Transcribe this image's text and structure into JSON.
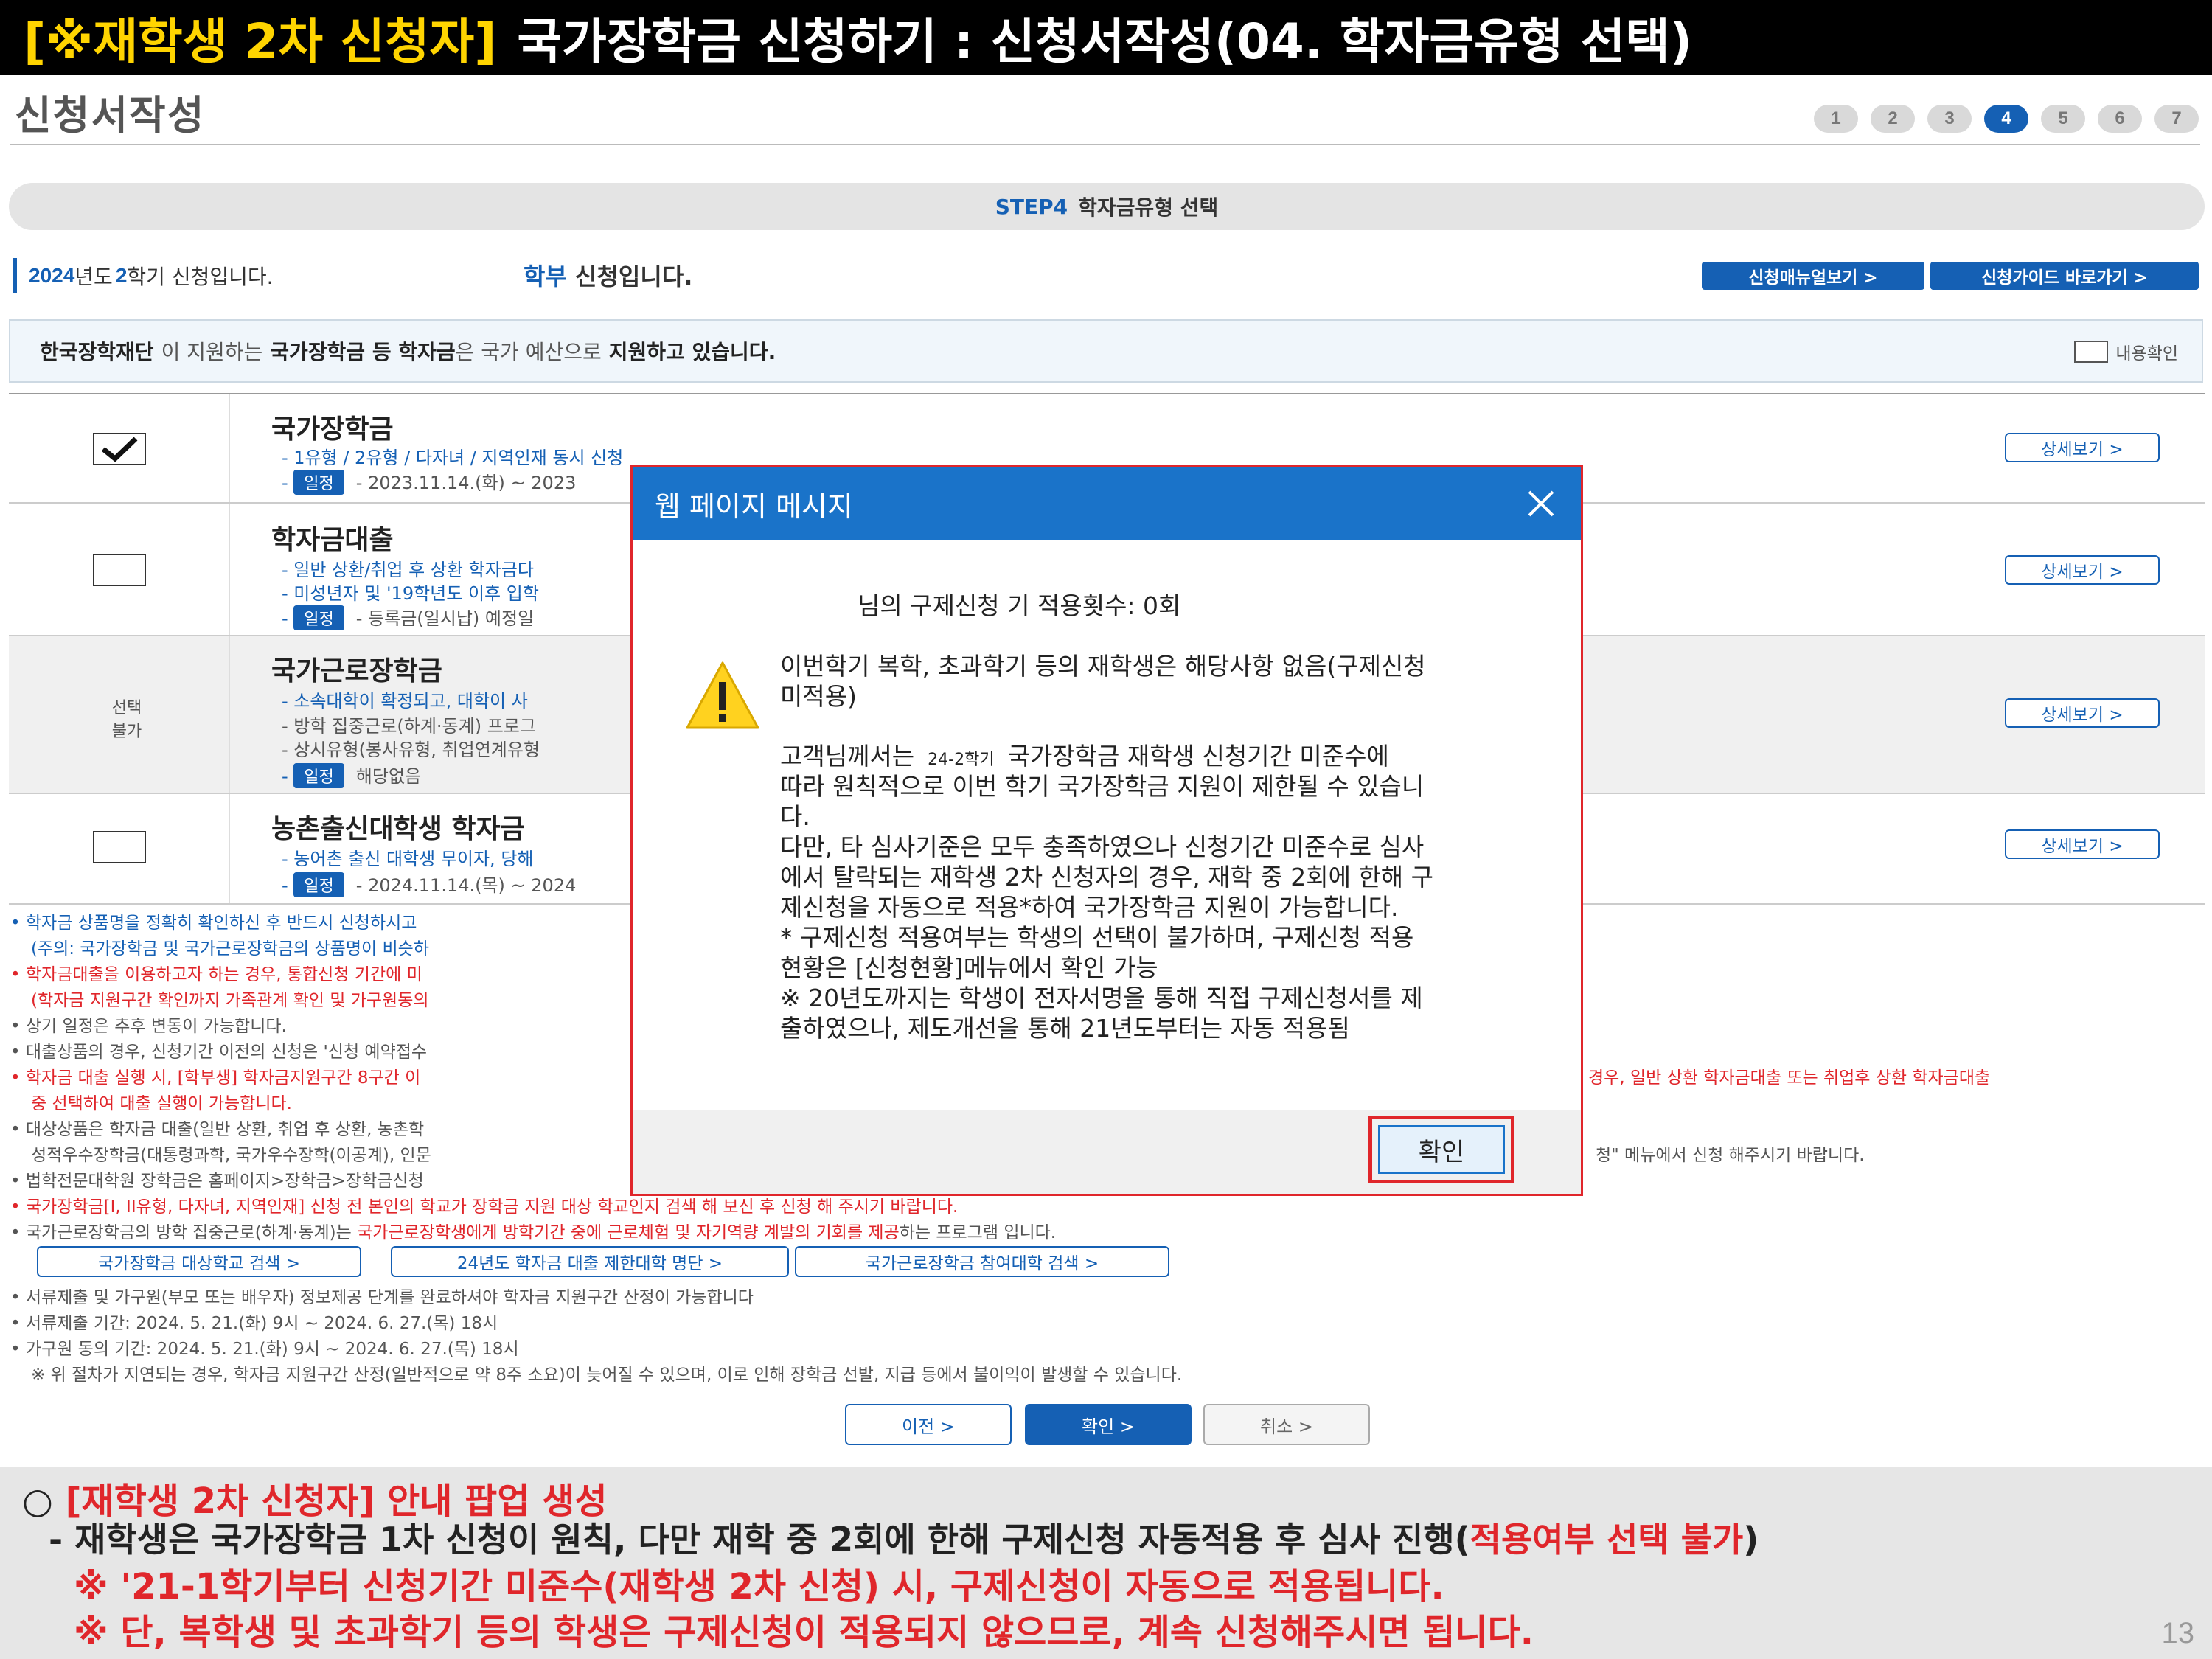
{
  "slide": {
    "title_highlight": "[※재학생 2차 신청자]",
    "title_rest": "국가장학금 신청하기 : 신청서작성(04. 학자금유형 선택)",
    "page_number": "13"
  },
  "page": {
    "title": "신청서작성",
    "steps": [
      "1",
      "2",
      "3",
      "4",
      "5",
      "6",
      "7"
    ],
    "active_step": "4",
    "step_banner_no": "STEP4",
    "step_banner_text": "학자금유형 선택",
    "semester_year": "2024",
    "semester_year_suffix": "년도",
    "semester_term": "2",
    "semester_suffix": "학기 신청입니다.",
    "apply_type_blue": "학부",
    "apply_type_rest": "신청입니다.",
    "manual_button": "신청매뉴얼보기 >",
    "guide_button": "신청가이드 바로가기 >",
    "notice_org": "한국장학재단",
    "notice_mid1": "이 지원하는",
    "notice_item": "국가장학금 등 학자금",
    "notice_mid2": "은 국가 예산으로",
    "notice_end": "지원하고 있습니다.",
    "confirm_label": "내용확인"
  },
  "list": {
    "detail_label": "상세보기 >",
    "disabled_label_1": "선택",
    "disabled_label_2": "불가",
    "badge_label": "일정",
    "rows": [
      {
        "title": "국가장학금",
        "checked": true,
        "sub1": "- 1유형 / 2유형 / 다자녀 / 지역인재 동시 신청",
        "schedule": "- 2023.11.14.(화) ~ 2023"
      },
      {
        "title": "학자금대출",
        "checked": false,
        "sub1": "- 일반 상환/취업 후 상환 학자금다",
        "sub2": "- 미성년자 및 '19학년도 이후 입학",
        "schedule": "- 등록금(일시납) 예정일"
      },
      {
        "title": "국가근로장학금",
        "disabled": true,
        "sub1": "- 소속대학이 확정되고, 대학이 사",
        "sub2": "- 방학 집중근로(하계·동계) 프로그",
        "sub3": "- 상시유형(봉사유형, 취업연계유형",
        "schedule": "해당없음"
      },
      {
        "title": "농촌출신대학생 학자금",
        "checked": false,
        "sub1": "- 농어촌 출신 대학생 무이자, 당해",
        "schedule": "- 2024.11.14.(목) ~ 2024"
      }
    ]
  },
  "notes": [
    {
      "text": "• 학자금 상품명을 정확히 확인하신 후 반드시 신청하시고",
      "color": "blue"
    },
    {
      "text": "(주의: 국가장학금 및 국가근로장학금의 상품명이 비슷하",
      "color": "blue"
    },
    {
      "text": "• 학자금대출을 이용하고자 하는 경우, 통합신청 기간에 미",
      "color": "red"
    },
    {
      "text": "(학자금 지원구간 확인까지 가족관계 확인 및 가구원동의",
      "color": "red"
    },
    {
      "text": "• 상기 일정은 추후 변동이 가능합니다.",
      "color": "gray"
    },
    {
      "text": "• 대출상품의 경우, 신청기간 이전의 신청은 '신청 예약접수",
      "color": "gray"
    },
    {
      "text": "• 학자금 대출 실행 시, [학부생] 학자금지원구간 8구간 이",
      "color": "red"
    },
    {
      "text": "경우, 일반 상환 학자금대출 또는 취업후 상환 학자금대출",
      "color": "red"
    },
    {
      "text": "중 선택하여 대출 실행이 가능합니다.",
      "color": "red"
    },
    {
      "text": "• 대상상품은 학자금 대출(일반 상환, 취업 후 상환, 농촌학",
      "color": "gray"
    },
    {
      "text": "성적우수장학금(대통령과학, 국가우수장학(이공계), 인문",
      "color": "gray"
    },
    {
      "text": "청\" 메뉴에서 신청 해주시기 바랍니다.",
      "color": "gray"
    },
    {
      "text": "• 법학전문대학원 장학금은 홈페이지>장학금>장학금신청",
      "color": "gray"
    },
    {
      "text": "• 국가장학금[I, II유형, 다자녀, 지역인재] 신청 전 본인의 학교가 장학금 지원 대상 학교인지 검색 해 보신 후 신청 해 주시기 바랍니다.",
      "color": "red"
    },
    {
      "text": "• 국가근로장학금의 방학 집중근로(하계·동계)는",
      "color": "gray"
    },
    {
      "text": "국가근로장학생에게 방학기간 중에 근로체험 및 자기역량 계발의 기회를 제공",
      "color": "red"
    },
    {
      "text": "하는 프로그램 입니다.",
      "color": "gray"
    },
    {
      "text": "• 서류제출 및 가구원(부모 또는 배우자) 정보제공 단계를 완료하셔야 학자금 지원구간 산정이 가능합니다",
      "color": "gray"
    },
    {
      "text": "• 서류제출 기간: 2024. 5. 21.(화) 9시 ~ 2024. 6. 27.(목) 18시",
      "color": "gray"
    },
    {
      "text": "• 가구원 동의 기간: 2024. 5. 21.(화) 9시 ~ 2024. 6. 27.(목) 18시",
      "color": "gray"
    },
    {
      "text": "※ 위 절차가 지연되는 경우, 학자금 지원구간 산정(일반적으로 약 8주 소요)이 늦어질 수 있으며, 이로 인해 장학금 선발, 지급 등에서 불이익이 발생할 수 있습니다.",
      "color": "gray"
    }
  ],
  "links": {
    "school_search": "국가장학금 대상학교 검색 >",
    "loan_limit": "24년도 학자금 대출 제한대학 명단 >",
    "work_school": "국가근로장학금 참여대학 검색 >"
  },
  "nav": {
    "prev": "이전 >",
    "ok": "확인 >",
    "cancel": "취소 >"
  },
  "dialog": {
    "title": "웹 페이지 메시지",
    "line1": "님의 구제신청 기 적용횟수: 0회",
    "line2": "이번학기 복학, 초과학기 등의 재학생은 해당사항 없음(구제신청",
    "line3": "미적용)",
    "line4_pre": "고객님께서는",
    "line4_term": "24-2학기",
    "line4_post": "국가장학금 재학생 신청기간 미준수에",
    "line5": "따라 원칙적으로 이번 학기 국가장학금 지원이 제한될 수 있습니",
    "line6": "다.",
    "line7": "다만, 타 심사기준은 모두 충족하였으나 신청기간 미준수로 심사",
    "line8": "에서 탈락되는 재학생 2차 신청자의 경우, 재학 중 2회에 한해 구",
    "line9": "제신청을 자동으로 적용*하여 국가장학금 지원이 가능합니다.",
    "line10": "* 구제신청 적용여부는 학생의 선택이 불가하며, 구제신청 적용",
    "line11": "현황은 [신청현황]메뉴에서 확인 가능",
    "line12": "※ 20년도까지는 학생이 전자서명을 통해 직접 구제신청서를 제",
    "line13": "출하였으나, 제도개선을 통해 21년도부터는 자동 적용됨",
    "ok": "확인"
  },
  "guide": {
    "circle": "○",
    "head_red": "[재학생 2차 신청자] 안내 팝업 생성",
    "line2_pre": "- 재학생은 국가장학금 1차 신청이 원칙, 다만 재학 중 2회에 한해 구제신청 자동적용 후 심사 진행(",
    "line2_red": "적용여부 선택 불가",
    "line2_post": ")",
    "line3": "※ '21-1학기부터 신청기간 미준수(재학생 2차 신청) 시, 구제신청이 자동으로 적용됩니다.",
    "line4": "※ 단, 복학생 및 초과학기 등의 학생은 구제신청이 적용되지 않으므로, 계속 신청해주시면 됩니다."
  }
}
